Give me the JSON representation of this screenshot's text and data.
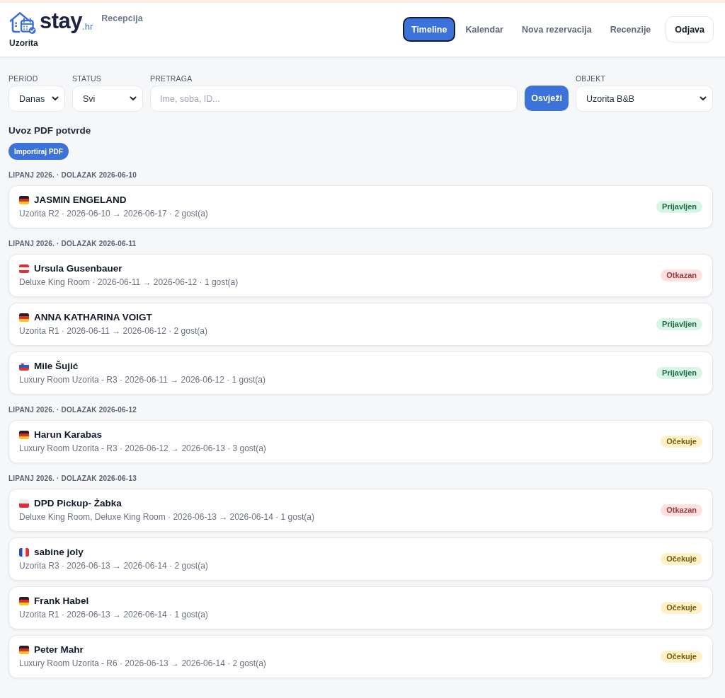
{
  "header": {
    "brand": {
      "name": "stay",
      "suffix": ".hr"
    },
    "section": "Recepcija",
    "property": "Uzorita",
    "nav": [
      {
        "label": "Timeline",
        "selected": true
      },
      {
        "label": "Kalendar",
        "selected": false
      },
      {
        "label": "Nova rezervacija",
        "selected": false
      },
      {
        "label": "Recenzije",
        "selected": false
      }
    ],
    "logout": "Odjava"
  },
  "filters": {
    "period": {
      "label": "PERIOD",
      "value": "Danas"
    },
    "status": {
      "label": "STATUS",
      "value": "Svi"
    },
    "search": {
      "label": "PRETRAGA",
      "placeholder": "Ime, soba, ID..."
    },
    "refresh": "Osvježi",
    "property": {
      "label": "OBJEKT",
      "value": "Uzorita B&B"
    }
  },
  "pdf_import": {
    "title": "Uvoz PDF potvrde",
    "button": "Importiraj PDF"
  },
  "groups": [
    {
      "heading": "LIPANJ 2026. · DOLAZAK 2026-06-10",
      "bookings": [
        {
          "flag": {
            "kind": "germany"
          },
          "guest": "JASMIN ENGELAND",
          "details": "Uzorita R2 · 2026-06-10 → 2026-06-17 · 2 gost(a)",
          "status": {
            "label": "Prijavljen",
            "kind": "checkedin"
          }
        }
      ]
    },
    {
      "heading": "LIPANJ 2026. · DOLAZAK 2026-06-11",
      "bookings": [
        {
          "flag": {
            "kind": "austria"
          },
          "guest": "Ursula Gusenbauer",
          "details": "Deluxe King Room · 2026-06-11 → 2026-06-12 · 1 gost(a)",
          "status": {
            "label": "Otkazan",
            "kind": "cancelled"
          }
        },
        {
          "flag": {
            "kind": "germany"
          },
          "guest": "ANNA KATHARINA VOIGT",
          "details": "Uzorita R1 · 2026-06-11 → 2026-06-12 · 2 gost(a)",
          "status": {
            "label": "Prijavljen",
            "kind": "checkedin"
          }
        },
        {
          "flag": {
            "kind": "slovenia"
          },
          "guest": "Mile Šujić",
          "details": "Luxury Room Uzorita - R3 · 2026-06-11 → 2026-06-12 · 1 gost(a)",
          "status": {
            "label": "Prijavljen",
            "kind": "checkedin"
          }
        }
      ]
    },
    {
      "heading": "LIPANJ 2026. · DOLAZAK 2026-06-12",
      "bookings": [
        {
          "flag": {
            "kind": "germany"
          },
          "guest": "Harun Karabas",
          "details": "Luxury Room Uzorita - R3 · 2026-06-12 → 2026-06-13 · 3 gost(a)",
          "status": {
            "label": "Očekuje",
            "kind": "pending"
          }
        }
      ]
    },
    {
      "heading": "LIPANJ 2026. · DOLAZAK 2026-06-13",
      "bookings": [
        {
          "flag": {
            "kind": "poland"
          },
          "guest": "DPD Pickup- Żabka",
          "details": "Deluxe King Room, Deluxe King Room · 2026-06-13 → 2026-06-14 · 1 gost(a)",
          "status": {
            "label": "Otkazan",
            "kind": "cancelled"
          }
        },
        {
          "flag": {
            "kind": "france"
          },
          "guest": "sabine joly",
          "details": "Uzorita R3 · 2026-06-13 → 2026-06-14 · 2 gost(a)",
          "status": {
            "label": "Očekuje",
            "kind": "pending"
          }
        },
        {
          "flag": {
            "kind": "germany"
          },
          "guest": "Frank Habel",
          "details": "Uzorita R1 · 2026-06-13 → 2026-06-14 · 1 gost(a)",
          "status": {
            "label": "Očekuje",
            "kind": "pending"
          }
        },
        {
          "flag": {
            "kind": "germany"
          },
          "guest": "Peter Mahr",
          "details": "Luxury Room Uzorita - R6 · 2026-06-13 → 2026-06-14 · 2 gost(a)",
          "status": {
            "label": "Očekuje",
            "kind": "pending"
          }
        }
      ]
    }
  ]
}
